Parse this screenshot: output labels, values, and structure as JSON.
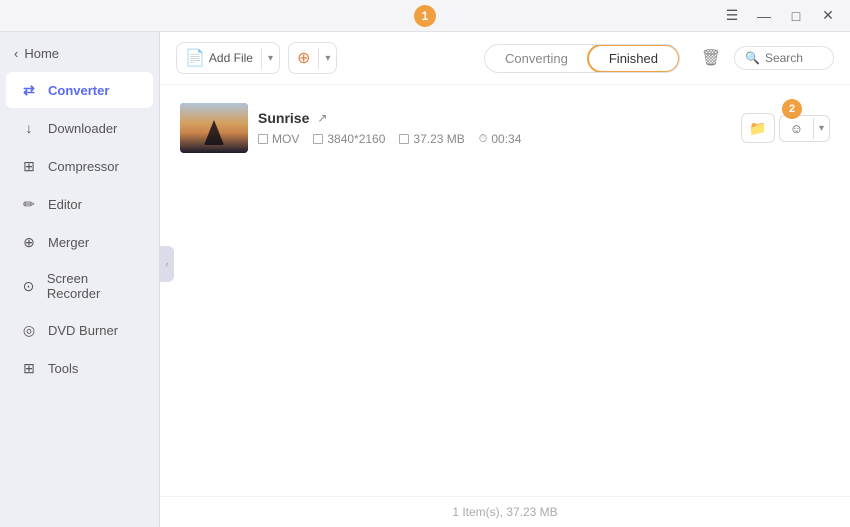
{
  "titlebar": {
    "badge_number": "1",
    "buttons": {
      "menu": "☰",
      "minimize": "—",
      "maximize": "□",
      "close": "✕"
    }
  },
  "sidebar": {
    "back_label": "Home",
    "items": [
      {
        "id": "converter",
        "label": "Converter",
        "icon": "⇄",
        "active": true
      },
      {
        "id": "downloader",
        "label": "Downloader",
        "icon": "↓"
      },
      {
        "id": "compressor",
        "label": "Compressor",
        "icon": "⊞"
      },
      {
        "id": "editor",
        "label": "Editor",
        "icon": "✏"
      },
      {
        "id": "merger",
        "label": "Merger",
        "icon": "⊕"
      },
      {
        "id": "screen-recorder",
        "label": "Screen Recorder",
        "icon": "⊙"
      },
      {
        "id": "dvd-burner",
        "label": "DVD Burner",
        "icon": "◎"
      },
      {
        "id": "tools",
        "label": "Tools",
        "icon": "⊞"
      }
    ]
  },
  "toolbar": {
    "add_file_label": "Add File",
    "add_options_label": "",
    "converting_tab": "Converting",
    "finished_tab": "Finished",
    "search_placeholder": "Search"
  },
  "files": [
    {
      "name": "Sunrise",
      "format": "MOV",
      "resolution": "3840*2160",
      "size": "37.23 MB",
      "duration": "00:34"
    }
  ],
  "footer": {
    "summary": "1 Item(s), 37.23 MB"
  },
  "action_badge": "2",
  "icons": {
    "back_arrow": "‹",
    "external_link": "↗",
    "search": "🔍",
    "trash": "🗑",
    "folder": "📁",
    "face": "☺",
    "chevron_down": "▾",
    "collapse": "‹"
  }
}
